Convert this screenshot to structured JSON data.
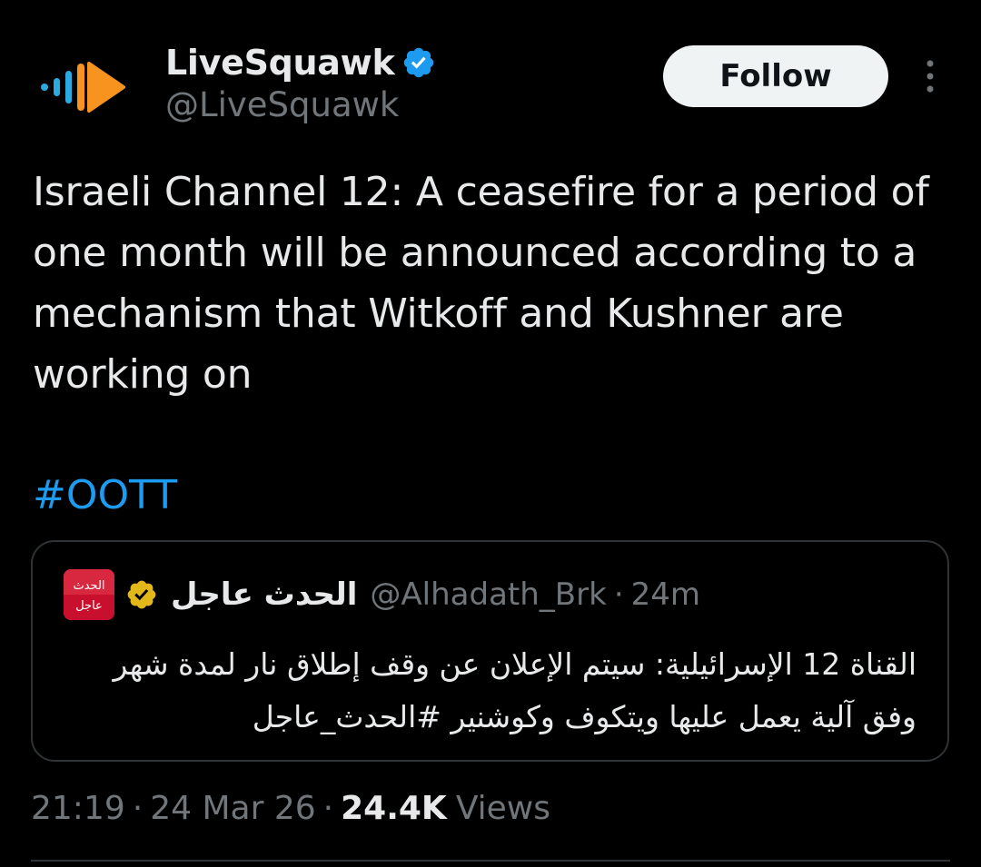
{
  "author": {
    "display_name": "LiveSquawk",
    "handle": "@LiveSquawk",
    "avatar_icon": "livesquawk-logo-icon",
    "verified_icon": "verified-badge-icon",
    "verified_color": "#1d9bf0"
  },
  "follow_button": {
    "label": "Follow"
  },
  "more_icon": "more-vertical-icon",
  "tweet": {
    "text": "Israeli Channel 12: A ceasefire for a period of one month will be announced according to a mechanism that Witkoff and Kushner are working on",
    "hashtag": "#OOTT"
  },
  "quote": {
    "avatar_text": "الحدث عاجل",
    "display_name": "الحدث عاجل",
    "verified_icon": "gold-verified-badge-icon",
    "verified_color": "#e2b719",
    "handle": "@Alhadath_Brk",
    "separator": "·",
    "time": "24m",
    "text": "القناة 12 الإسرائيلية: سيتم الإعلان عن وقف إطلاق نار لمدة شهر وفق آلية يعمل عليها ويتكوف وكوشنير #الحدث_عاجل"
  },
  "meta": {
    "time": "21:19",
    "separator": "·",
    "date": "24 Mar 26",
    "views_count": "24.4K",
    "views_label": "Views"
  },
  "colors": {
    "background": "#000000",
    "text_primary": "#e7e9ea",
    "text_secondary": "#71767b",
    "link": "#1d9bf0",
    "border": "#2f3336",
    "logo_orange": "#f7931e",
    "logo_blue": "#29abe2"
  }
}
